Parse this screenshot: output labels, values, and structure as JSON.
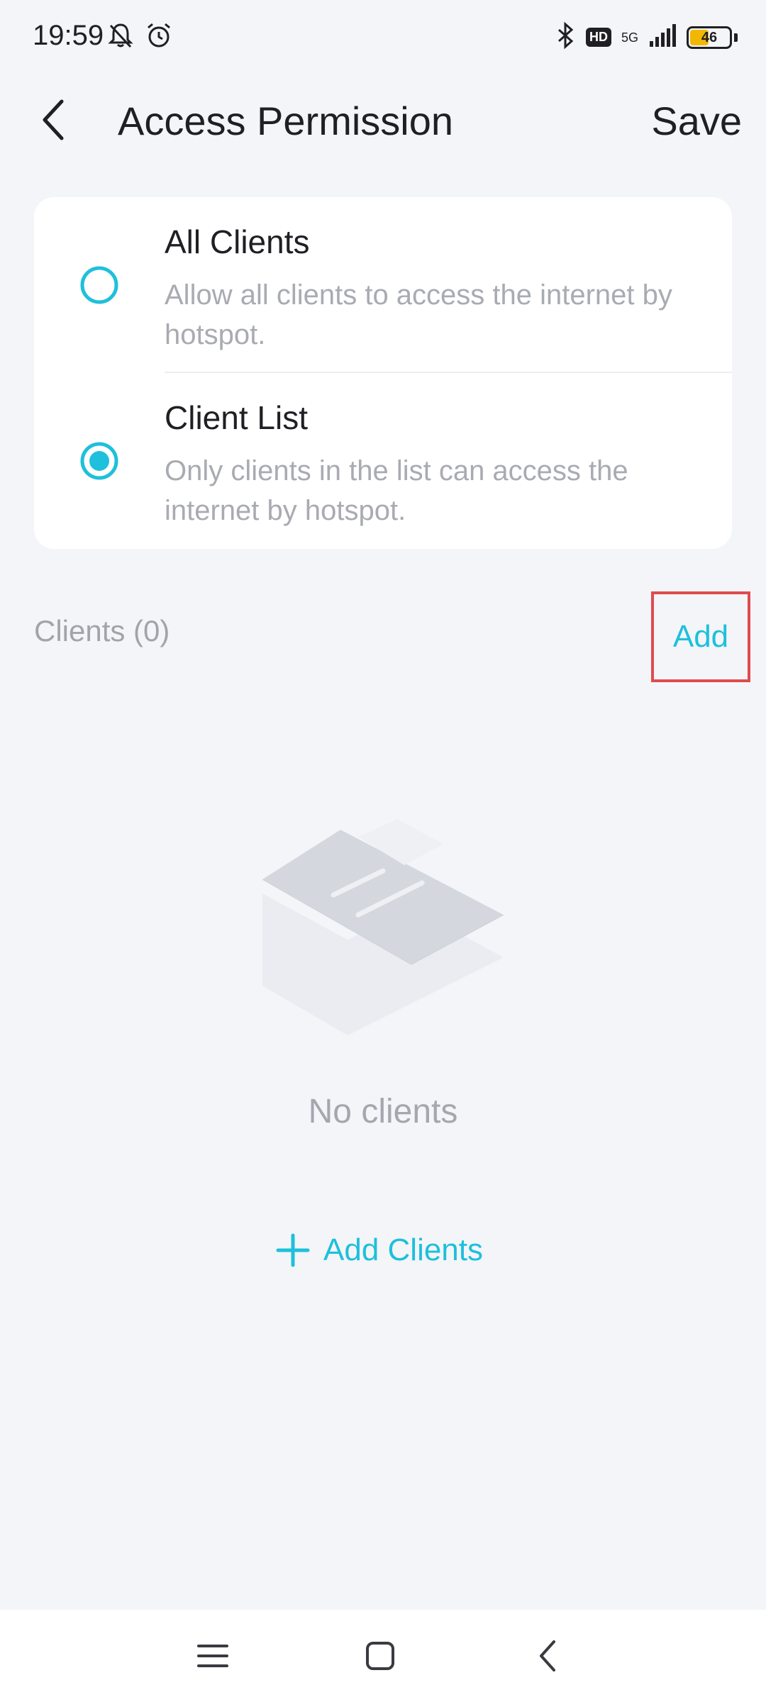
{
  "status_bar": {
    "time": "19:59",
    "hd": "HD",
    "network": "5G",
    "battery": "46",
    "icons": [
      "bell-off-icon",
      "alarm-icon",
      "bluetooth-icon",
      "signal-icon",
      "battery-icon"
    ]
  },
  "header": {
    "title": "Access Permission",
    "save_label": "Save"
  },
  "options": [
    {
      "title": "All Clients",
      "description": "Allow all clients to access the internet by hotspot.",
      "selected": false
    },
    {
      "title": "Client List",
      "description": "Only clients in the list can access the internet by hotspot.",
      "selected": true
    }
  ],
  "clients": {
    "label": "Clients (0)",
    "add_label": "Add"
  },
  "empty_state": {
    "text": "No clients",
    "add_clients_label": "Add Clients"
  },
  "colors": {
    "accent": "#1ec0db",
    "highlight": "#e04b4e",
    "background": "#f4f5f9"
  },
  "nav": {
    "icons": [
      "menu-icon",
      "home-square-icon",
      "back-chevron-icon"
    ]
  }
}
